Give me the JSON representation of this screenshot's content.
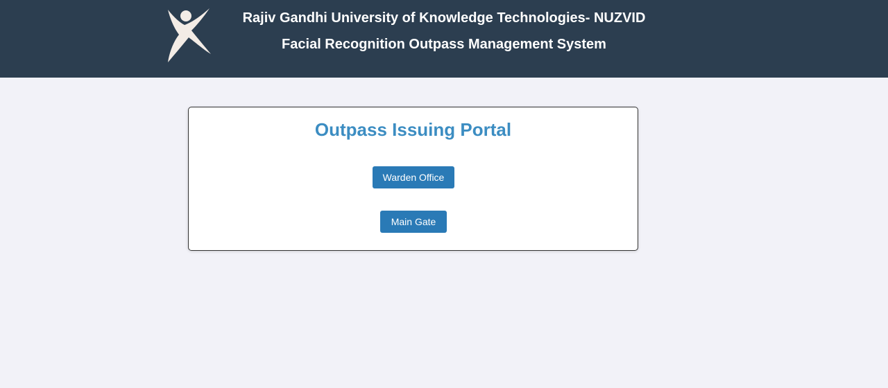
{
  "header": {
    "logo_icon": "rgukt-figure-logo-icon",
    "university_name": "Rajiv Gandhi University of Knowledge Technologies- NUZVID",
    "system_name": "Facial Recognition Outpass Management System",
    "background_color": "#2c3e50"
  },
  "portal": {
    "title": "Outpass Issuing Portal",
    "title_color": "#3c8dc2",
    "buttons": [
      {
        "label": "Warden Office"
      },
      {
        "label": "Main Gate"
      }
    ],
    "button_color": "#2a7ab6"
  },
  "page": {
    "background_color": "#f2f2f8"
  }
}
